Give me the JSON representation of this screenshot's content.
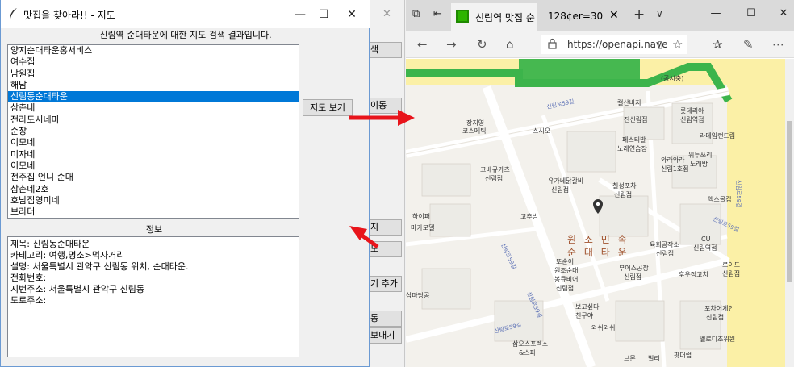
{
  "bg_app": {
    "buttons": [
      "색",
      "이동",
      "지",
      "도",
      "기 추가",
      "동",
      "보내기"
    ]
  },
  "main": {
    "title": "맛집을 찾아라!! - 지도",
    "header": "신림역 순대타운에 대한 지도 검색 결과입니다.",
    "list_items": [
      "양지순대타운홍서비스",
      "여수집",
      "남원집",
      "해남",
      "신림동순대타운",
      "삼촌네",
      "전라도시네마",
      "순창",
      "이모네",
      "미자네",
      "이모네",
      "전주집 언니 순대",
      "삼촌네2호",
      "호남집영미네",
      "브라더"
    ],
    "selected_index": 4,
    "map_button": "지도 보기",
    "info_label": "정보",
    "info_lines": [
      "제목: 신림동순대타운",
      "카테고리: 여행,명소>먹자거리",
      "설명: 서울특별시 관악구 신림동 위치, 순대타운.",
      "전화번호:",
      "지번주소: 서울특별시 관악구 신림동",
      "도로주소:"
    ]
  },
  "browser": {
    "tab1_title": "신림역 맛집 순",
    "tab2_title": "128¢er=30",
    "url": "https://openapi.nave",
    "map_labels": {
      "center_name": "원 조 민 속",
      "center_name2": "순 대 타 운",
      "places": [
        "(공시충)",
        "롯데리아",
        "신림역점",
        "캘산바지",
        "진신림점",
        "장지영",
        "코스메틱",
        "스시오",
        "라데임랜드림",
        "페스티발",
        "노래연습장",
        "워투쓰리",
        "노래방",
        "와라와라",
        "신림1호점",
        "고베규카츠",
        "신림점",
        "유가네닭갈비",
        "신림점",
        "칠성포차",
        "신림점",
        "엑스골컵",
        "고추방",
        "하이퍼",
        "마카모델",
        "육회공작소",
        "신림점",
        "CU",
        "신림역점",
        "또순이",
        "원조순대",
        "부어스공장",
        "신림점",
        "후우정고치",
        "로이드",
        "신림점",
        "봉큐비어",
        "신림점",
        "포차어게인",
        "신림점",
        "보고싶다",
        "친구야",
        "와쉬와쉬",
        "멜로디조위원",
        "삼오스포렉스",
        "&스파",
        "팟더럽",
        "빌리",
        "브몬"
      ],
      "roads": [
        "신림로59길",
        "신림로59길",
        "신림로59길",
        "신림로59길",
        "신림로59길",
        "신림로59길"
      ]
    }
  }
}
